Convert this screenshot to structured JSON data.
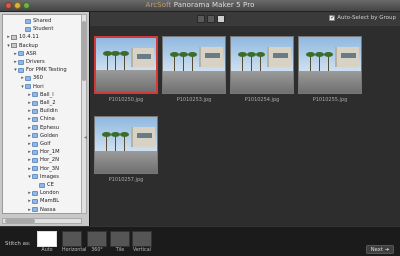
{
  "window": {
    "title_brand": "ArcSoft",
    "title_text": "Panorama Maker 5 Pro"
  },
  "toolbar": {
    "view_modes": [
      "large",
      "medium",
      "small"
    ],
    "auto_select_label": "Auto-Select by Group",
    "auto_select_checked": true
  },
  "sidebar": {
    "tree": [
      {
        "label": "Shared",
        "indent": 3,
        "kind": "folder",
        "tri": ""
      },
      {
        "label": "Student",
        "indent": 3,
        "kind": "folder",
        "tri": ""
      },
      {
        "label": "10.4.11",
        "indent": 1,
        "kind": "drive",
        "tri": "▸"
      },
      {
        "label": "Backup",
        "indent": 1,
        "kind": "drive",
        "tri": "▾"
      },
      {
        "label": "ASR",
        "indent": 2,
        "kind": "folder",
        "tri": "▸"
      },
      {
        "label": "Drivers",
        "indent": 2,
        "kind": "folder",
        "tri": "▸"
      },
      {
        "label": "For PMK Testing",
        "indent": 2,
        "kind": "folder",
        "tri": "▾"
      },
      {
        "label": "360",
        "indent": 3,
        "kind": "folder",
        "tri": "▸"
      },
      {
        "label": "Hori",
        "indent": 3,
        "kind": "folder",
        "tri": "▾"
      },
      {
        "label": "Ball_l",
        "indent": 4,
        "kind": "folder",
        "tri": "▸"
      },
      {
        "label": "Ball_2",
        "indent": 4,
        "kind": "folder",
        "tri": "▸"
      },
      {
        "label": "Buildin",
        "indent": 4,
        "kind": "folder",
        "tri": "▸"
      },
      {
        "label": "China",
        "indent": 4,
        "kind": "folder",
        "tri": "▸"
      },
      {
        "label": "Ephesu",
        "indent": 4,
        "kind": "folder",
        "tri": "▸"
      },
      {
        "label": "Golden",
        "indent": 4,
        "kind": "folder",
        "tri": "▸"
      },
      {
        "label": "Golf",
        "indent": 4,
        "kind": "folder",
        "tri": "▸"
      },
      {
        "label": "Hor_1M",
        "indent": 4,
        "kind": "folder",
        "tri": "▸"
      },
      {
        "label": "Hor_2N",
        "indent": 4,
        "kind": "folder",
        "tri": "▸"
      },
      {
        "label": "Hor_3N",
        "indent": 4,
        "kind": "folder",
        "tri": "▸"
      },
      {
        "label": "Images",
        "indent": 4,
        "kind": "folder",
        "tri": "▾"
      },
      {
        "label": "CE",
        "indent": 5,
        "kind": "folder",
        "tri": ""
      },
      {
        "label": "London",
        "indent": 4,
        "kind": "folder",
        "tri": "▸"
      },
      {
        "label": "MamBL",
        "indent": 4,
        "kind": "folder",
        "tri": "▸"
      },
      {
        "label": "Nassa",
        "indent": 4,
        "kind": "folder",
        "tri": "▸"
      }
    ]
  },
  "images": [
    {
      "caption": "P1010250.jpg",
      "selected": true
    },
    {
      "caption": "P1010253.jpg",
      "selected": false
    },
    {
      "caption": "P1010254.jpg",
      "selected": false
    },
    {
      "caption": "P1010255.jpg",
      "selected": false
    },
    {
      "caption": "P1010257.jpg",
      "selected": false
    }
  ],
  "bottombar": {
    "stitch_label": "Stitch as:",
    "modes": [
      {
        "label": "Auto",
        "active": true
      },
      {
        "label": "Horizontal",
        "active": false
      },
      {
        "label": "360°",
        "active": false
      },
      {
        "label": "Tile",
        "active": false
      },
      {
        "label": "Vertical",
        "active": false
      }
    ],
    "next_label": "Next"
  }
}
